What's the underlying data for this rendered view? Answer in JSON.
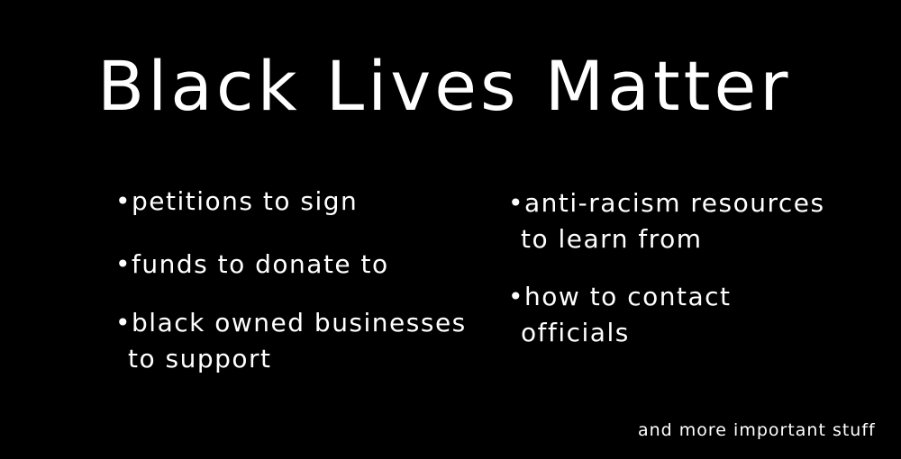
{
  "title": "Black Lives Matter",
  "left_column": [
    {
      "line1": "•petitions to sign",
      "line2": ""
    },
    {
      "line1": "•funds to donate to",
      "line2": ""
    },
    {
      "line1": "•black owned businesses",
      "line2": "to support"
    }
  ],
  "right_column": [
    {
      "line1": "•anti-racism resources",
      "line2": "to learn from"
    },
    {
      "line1": "•how to contact",
      "line2": "officials"
    }
  ],
  "footer": "and more important stuff",
  "colors": {
    "background": "#000000",
    "text": "#ffffff"
  }
}
